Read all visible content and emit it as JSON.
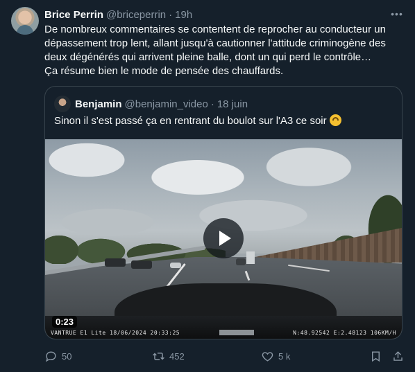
{
  "tweet": {
    "author_name": "Brice Perrin",
    "author_handle": "@briceperrin",
    "separator": "·",
    "time": "19h",
    "more_icon": "more-icon",
    "text": "De nombreux commentaires se contentent de reprocher au conducteur un dépassement trop lent, allant jusqu'à cautionner l'attitude criminogène des deux dégénérés qui arrivent pleine balle, dont un qui perd le contrôle…\nÇa résume bien le mode de pensée des chauffards."
  },
  "quote": {
    "author_name": "Benjamin",
    "author_handle": "@benjamin_video",
    "separator": "·",
    "date": "18 juin",
    "text": "Sinon il s'est passé ça en rentrant du boulot sur l'A3 ce soir",
    "video": {
      "duration": "0:23",
      "overlay_left": "VANTRUE E1 Lite 18/06/2024 20:33:25",
      "overlay_right": "N:48.92542 E:2.48123 106KM/H"
    }
  },
  "actions": {
    "reply_count": "50",
    "retweet_count": "452",
    "like_count": "5 k"
  },
  "colors": {
    "background": "#15202b",
    "text": "#f7f9f9",
    "secondary": "#8b98a5",
    "border": "#38444d"
  }
}
